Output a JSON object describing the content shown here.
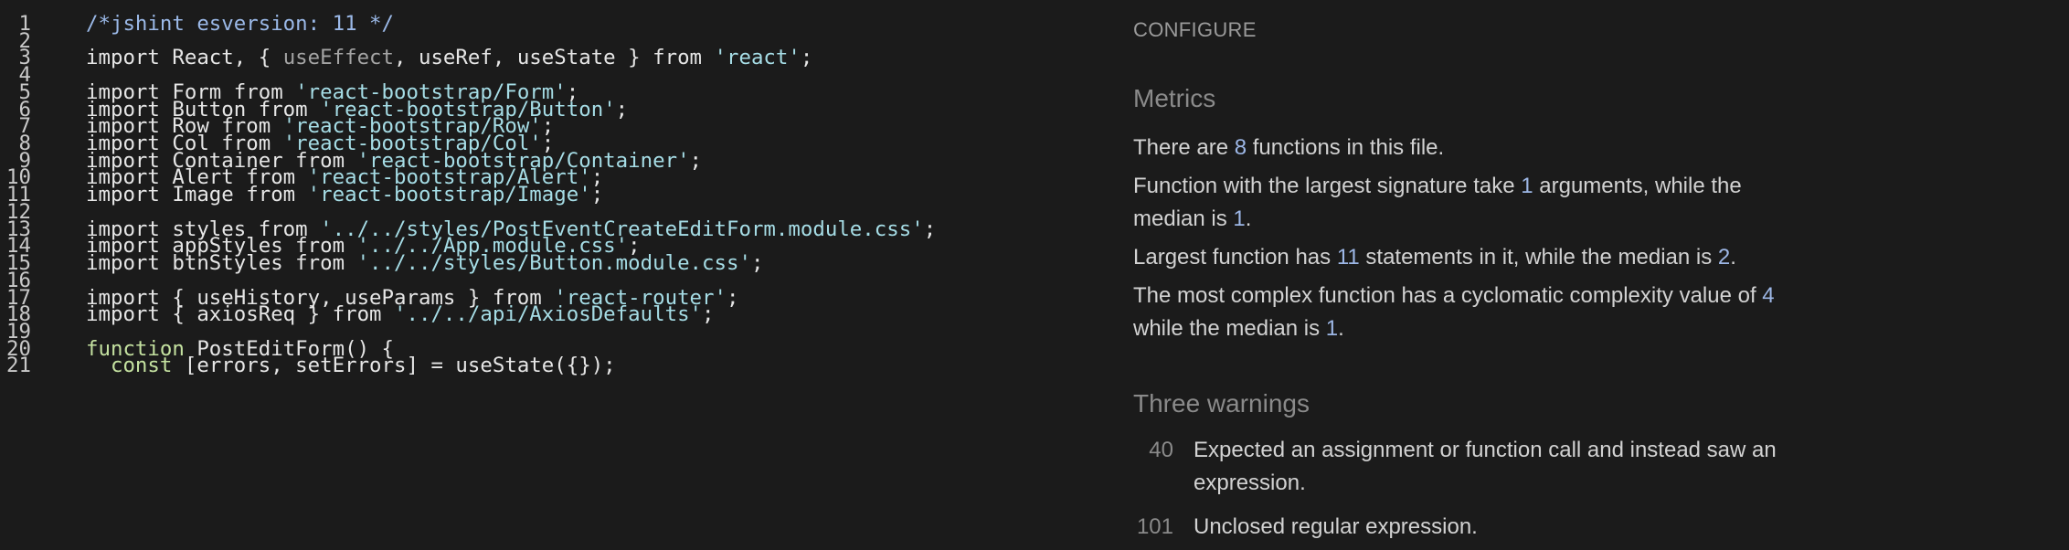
{
  "editor": {
    "lines": [
      {
        "n": "1",
        "tokens": [
          {
            "t": "/*jshint esversion: 11 */",
            "c": "comment"
          }
        ]
      },
      {
        "n": "2",
        "tokens": []
      },
      {
        "n": "3",
        "tokens": [
          {
            "t": "import React, { ",
            "c": "plain"
          },
          {
            "t": "useEffect",
            "c": "dim"
          },
          {
            "t": ", useRef, useState } from ",
            "c": "plain"
          },
          {
            "t": "'react'",
            "c": "string"
          },
          {
            "t": ";",
            "c": "plain"
          }
        ]
      },
      {
        "n": "4",
        "tokens": []
      },
      {
        "n": "5",
        "tokens": [
          {
            "t": "import Form from ",
            "c": "plain"
          },
          {
            "t": "'react-bootstrap/Form'",
            "c": "string"
          },
          {
            "t": ";",
            "c": "plain"
          }
        ]
      },
      {
        "n": "6",
        "tokens": [
          {
            "t": "import Button from ",
            "c": "plain"
          },
          {
            "t": "'react-bootstrap/Button'",
            "c": "string"
          },
          {
            "t": ";",
            "c": "plain"
          }
        ]
      },
      {
        "n": "7",
        "tokens": [
          {
            "t": "import Row from ",
            "c": "plain"
          },
          {
            "t": "'react-bootstrap/Row'",
            "c": "string"
          },
          {
            "t": ";",
            "c": "plain"
          }
        ]
      },
      {
        "n": "8",
        "tokens": [
          {
            "t": "import Col from ",
            "c": "plain"
          },
          {
            "t": "'react-bootstrap/Col'",
            "c": "string"
          },
          {
            "t": ";",
            "c": "plain"
          }
        ]
      },
      {
        "n": "9",
        "tokens": [
          {
            "t": "import Container from ",
            "c": "plain"
          },
          {
            "t": "'react-bootstrap/Container'",
            "c": "string"
          },
          {
            "t": ";",
            "c": "plain"
          }
        ]
      },
      {
        "n": "10",
        "tokens": [
          {
            "t": "import Alert from ",
            "c": "plain"
          },
          {
            "t": "'react-bootstrap/Alert'",
            "c": "string"
          },
          {
            "t": ";",
            "c": "plain"
          }
        ]
      },
      {
        "n": "11",
        "tokens": [
          {
            "t": "import Image from ",
            "c": "plain"
          },
          {
            "t": "'react-bootstrap/Image'",
            "c": "string"
          },
          {
            "t": ";",
            "c": "plain"
          }
        ]
      },
      {
        "n": "12",
        "tokens": []
      },
      {
        "n": "13",
        "tokens": [
          {
            "t": "import styles from ",
            "c": "plain"
          },
          {
            "t": "'../../styles/PostEventCreateEditForm.module.css'",
            "c": "string"
          },
          {
            "t": ";",
            "c": "plain"
          }
        ]
      },
      {
        "n": "14",
        "tokens": [
          {
            "t": "import appStyles from ",
            "c": "plain"
          },
          {
            "t": "'../../App.module.css'",
            "c": "string"
          },
          {
            "t": ";",
            "c": "plain"
          }
        ]
      },
      {
        "n": "15",
        "tokens": [
          {
            "t": "import btnStyles from ",
            "c": "plain"
          },
          {
            "t": "'../../styles/Button.module.css'",
            "c": "string"
          },
          {
            "t": ";",
            "c": "plain"
          }
        ]
      },
      {
        "n": "16",
        "tokens": []
      },
      {
        "n": "17",
        "tokens": [
          {
            "t": "import { useHistory, useParams } from ",
            "c": "plain"
          },
          {
            "t": "'react-router'",
            "c": "string"
          },
          {
            "t": ";",
            "c": "plain"
          }
        ]
      },
      {
        "n": "18",
        "tokens": [
          {
            "t": "import { axiosReq } from ",
            "c": "plain"
          },
          {
            "t": "'../../api/AxiosDefaults'",
            "c": "string"
          },
          {
            "t": ";",
            "c": "plain"
          }
        ]
      },
      {
        "n": "19",
        "tokens": []
      },
      {
        "n": "20",
        "tokens": [
          {
            "t": "function",
            "c": "keyword"
          },
          {
            "t": " PostEditForm() {",
            "c": "plain"
          }
        ]
      },
      {
        "n": "21",
        "tokens": [
          {
            "t": "  ",
            "c": "plain"
          },
          {
            "t": "const",
            "c": "keyword"
          },
          {
            "t": " [errors, setErrors] = useState({});",
            "c": "plain"
          }
        ]
      }
    ]
  },
  "panel": {
    "configure_label": "CONFIGURE",
    "metrics": {
      "heading": "Metrics",
      "p1": {
        "a": "There are ",
        "n": "8",
        "b": " functions in this file."
      },
      "p2": {
        "a": "Function with the largest signature take ",
        "n1": "1",
        "b": " arguments, while the median is ",
        "n2": "1",
        "c": "."
      },
      "p3": {
        "a": "Largest function has ",
        "n1": "11",
        "b": " statements in it, while the median is ",
        "n2": "2",
        "c": "."
      },
      "p4": {
        "a": "The most complex function has a cyclomatic complexity value of ",
        "n1": "4",
        "b": " while the median is ",
        "n2": "1",
        "c": "."
      }
    },
    "warnings": {
      "heading": "Three warnings",
      "items": [
        {
          "line": "40",
          "text": "Expected an assignment or function call and instead saw an expression."
        },
        {
          "line": "101",
          "text": "Unclosed regular expression."
        }
      ]
    }
  },
  "colors": {
    "background": "#1b1b1b",
    "comment": "#9bb9e8",
    "keyword": "#c4e1a0",
    "string": "#a6dde6",
    "number_highlight": "#9db7e6"
  }
}
